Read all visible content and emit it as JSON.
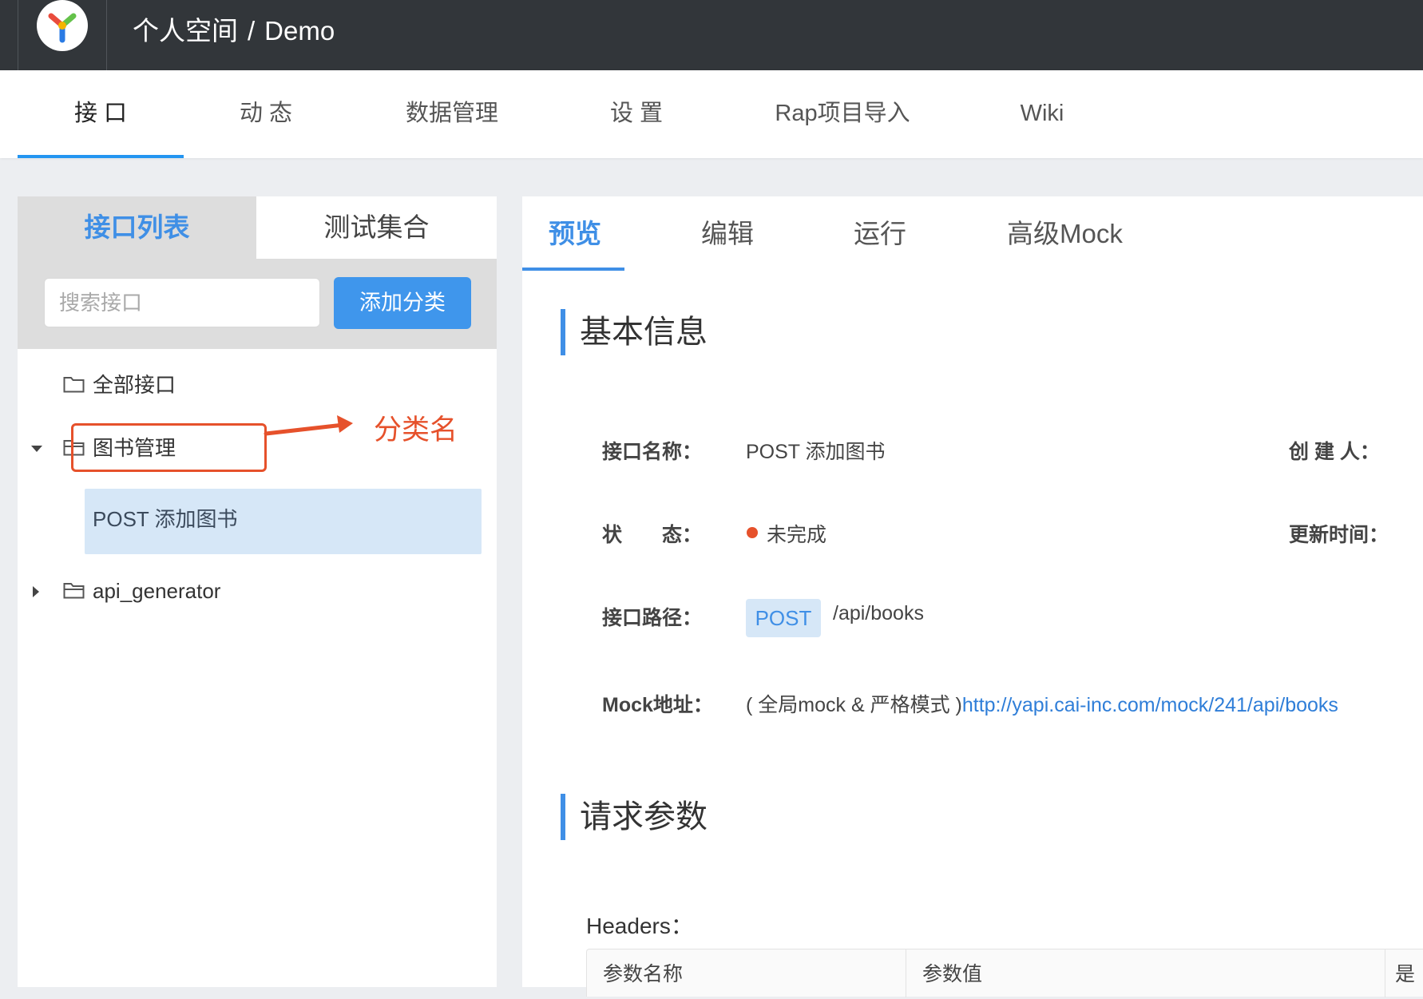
{
  "topbar": {
    "breadcrumb": [
      "个人空间",
      "Demo"
    ],
    "separator": "/"
  },
  "nav": {
    "tabs": [
      "接 口",
      "动 态",
      "数据管理",
      "设 置",
      "Rap项目导入",
      "Wiki"
    ],
    "active": "接 口"
  },
  "sidebar": {
    "tabs": [
      "接口列表",
      "测试集合"
    ],
    "search_placeholder": "搜索接口",
    "add_category_label": "添加分类",
    "tree": {
      "all": "全部接口",
      "category": "图书管理",
      "item": "POST 添加图书",
      "category2": "api_generator"
    }
  },
  "annotation": {
    "label": "分类名"
  },
  "detail": {
    "tabs": [
      "预览",
      "编辑",
      "运行",
      "高级Mock"
    ],
    "active_tab": "预览",
    "basic_info_title": "基本信息",
    "fields": {
      "name_label": "接口名称：",
      "name_value": "POST 添加图书",
      "creator_label": "创 建 人：",
      "status_label": "状　　态：",
      "status_value": "未完成",
      "updated_label": "更新时间：",
      "path_label": "接口路径：",
      "method": "POST",
      "path": "/api/books",
      "mock_label": "Mock地址：",
      "mock_note": "( 全局mock & 严格模式 )",
      "mock_url": "http://yapi.cai-inc.com/mock/241/api/books"
    },
    "request_title": "请求参数",
    "headers_label": "Headers：",
    "table_headers": [
      "参数名称",
      "参数值",
      "是"
    ]
  },
  "colors": {
    "accent": "#3f8fe6",
    "annotation": "#e6512b",
    "topbar": "#32363a"
  }
}
